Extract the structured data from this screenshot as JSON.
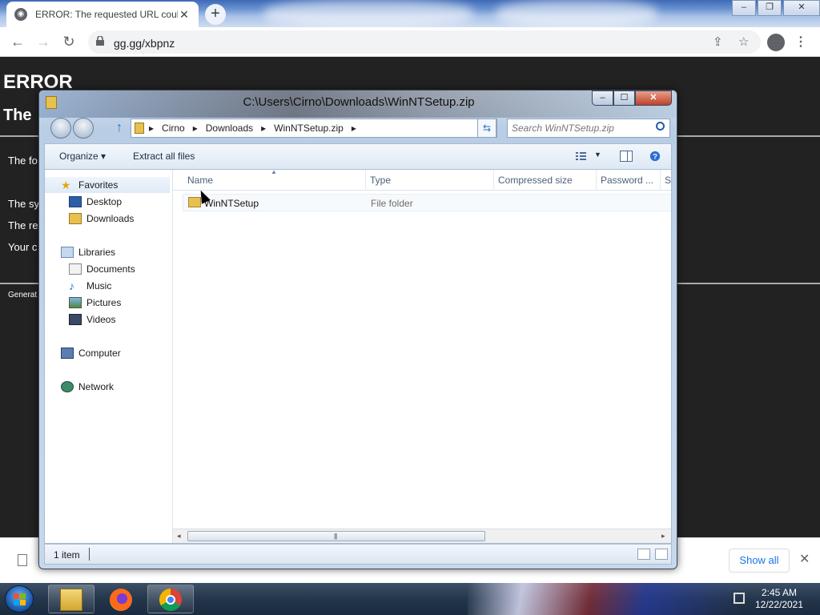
{
  "browser": {
    "tab_title": "ERROR: The requested URL could",
    "url": "gg.gg/xbpnz",
    "new_tab_label": "+"
  },
  "page": {
    "heading": "ERROR",
    "subheading": "The",
    "frag1": "The fo",
    "frag2": "The sy",
    "frag3": "The re",
    "frag4": "Your c",
    "footer": "Generat"
  },
  "download_bar": {
    "show_all": "Show all"
  },
  "explorer": {
    "title": "C:\\Users\\Cirno\\Downloads\\WinNTSetup.zip",
    "breadcrumb": [
      "Cirno",
      "Downloads",
      "WinNTSetup.zip"
    ],
    "search_placeholder": "Search WinNTSetup.zip",
    "commands": {
      "organize": "Organize",
      "extract": "Extract all files"
    },
    "nav": {
      "favorites": "Favorites",
      "desktop": "Desktop",
      "downloads": "Downloads",
      "libraries": "Libraries",
      "documents": "Documents",
      "music": "Music",
      "pictures": "Pictures",
      "videos": "Videos",
      "computer": "Computer",
      "network": "Network"
    },
    "columns": {
      "name": "Name",
      "type": "Type",
      "compressed_size": "Compressed size",
      "password": "Password ...",
      "size": "Si"
    },
    "files": [
      {
        "name": "WinNTSetup",
        "type": "File folder"
      }
    ],
    "status": "1 item"
  },
  "taskbar": {
    "time": "2:45 AM",
    "date": "12/22/2021"
  }
}
